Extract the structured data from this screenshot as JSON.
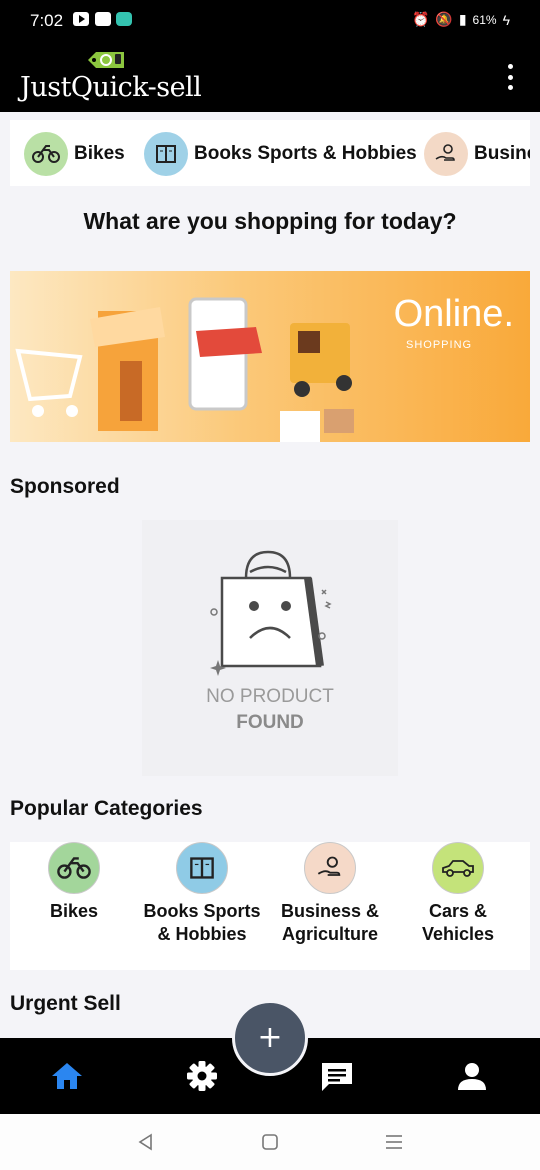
{
  "status_bar": {
    "time": "7:02",
    "battery": "61%",
    "icons": [
      "youtube-icon",
      "gallery-icon",
      "messenger-icon",
      "alarm-icon",
      "mute-icon",
      "signal-icon",
      "charging-icon"
    ]
  },
  "header": {
    "app_name": "JustQuick-sell",
    "menu_icon": "more-vertical-icon"
  },
  "category_strip": [
    {
      "label": "Bikes",
      "icon": "motorbike-icon",
      "color": "#b9e0a5"
    },
    {
      "label": "Books Sports & Hobbies",
      "icon": "book-icon",
      "color": "#9fd1e7"
    },
    {
      "label": "Busine",
      "icon": "money-hand-icon",
      "color": "#f3d9c6"
    }
  ],
  "headline": "What are you shopping for today?",
  "banner": {
    "title": "Online.",
    "subtitle": "SHOPPING"
  },
  "sponsored": {
    "title": "Sponsored",
    "empty_line1": "NO PRODUCT",
    "empty_line2": "FOUND"
  },
  "popular": {
    "title": "Popular Categories",
    "items": [
      {
        "label": "Bikes",
        "icon": "motorbike-icon",
        "color": "#a3d69b"
      },
      {
        "label": "Books Sports & Hobbies",
        "icon": "book-icon",
        "color": "#8fcbe6"
      },
      {
        "label": "Business & Agriculture",
        "icon": "money-hand-icon",
        "color": "#f5d9c8"
      },
      {
        "label": "Cars & Vehicles",
        "icon": "car-icon",
        "color": "#c4e37a"
      }
    ]
  },
  "urgent": {
    "title": "Urgent Sell"
  },
  "fab": {
    "label": "+"
  },
  "bottom_nav": [
    {
      "name": "home",
      "icon": "home-icon",
      "active": true,
      "color": "#2b86f0"
    },
    {
      "name": "settings",
      "icon": "gear-icon",
      "active": false,
      "color": "#ffffff"
    },
    {
      "name": "chat",
      "icon": "chat-icon",
      "active": false,
      "color": "#ffffff"
    },
    {
      "name": "profile",
      "icon": "user-icon",
      "active": false,
      "color": "#ffffff"
    }
  ]
}
